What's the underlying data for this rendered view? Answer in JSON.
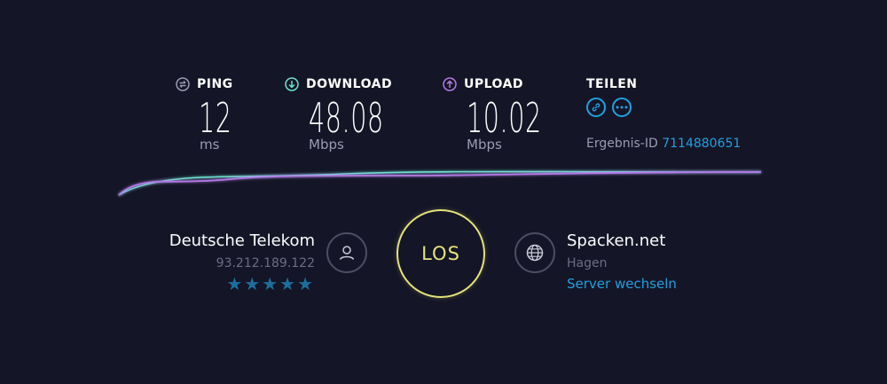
{
  "metrics": {
    "ping": {
      "label": "PING",
      "value": "12",
      "unit": "ms",
      "icon": "ping-icon",
      "icon_color": "#9b9cb3"
    },
    "download": {
      "label": "DOWNLOAD",
      "value": "48.08",
      "unit": "Mbps",
      "icon": "download-arrow-icon",
      "icon_color": "#6de3d0"
    },
    "upload": {
      "label": "UPLOAD",
      "value": "10.02",
      "unit": "Mbps",
      "icon": "upload-arrow-icon",
      "icon_color": "#b579e8"
    }
  },
  "share": {
    "label": "TEILEN",
    "link_icon": "link-icon",
    "more_icon": "more-icon",
    "result_label": "Ergebnis-ID",
    "result_id": "7114880651"
  },
  "isp": {
    "name": "Deutsche Telekom",
    "ip": "93.212.189.122",
    "rating": "★★★★★",
    "icon": "user-icon"
  },
  "go_button": {
    "label": "LOS"
  },
  "server": {
    "name": "Spacken.net",
    "location": "Hagen",
    "change_label": "Server wechseln",
    "icon": "globe-icon"
  },
  "colors": {
    "background": "#141526",
    "accent_blue": "#1fa1e0",
    "download": "#6de3d0",
    "upload": "#b579e8",
    "go": "#e6e37a",
    "muted": "#9b9cb3"
  }
}
